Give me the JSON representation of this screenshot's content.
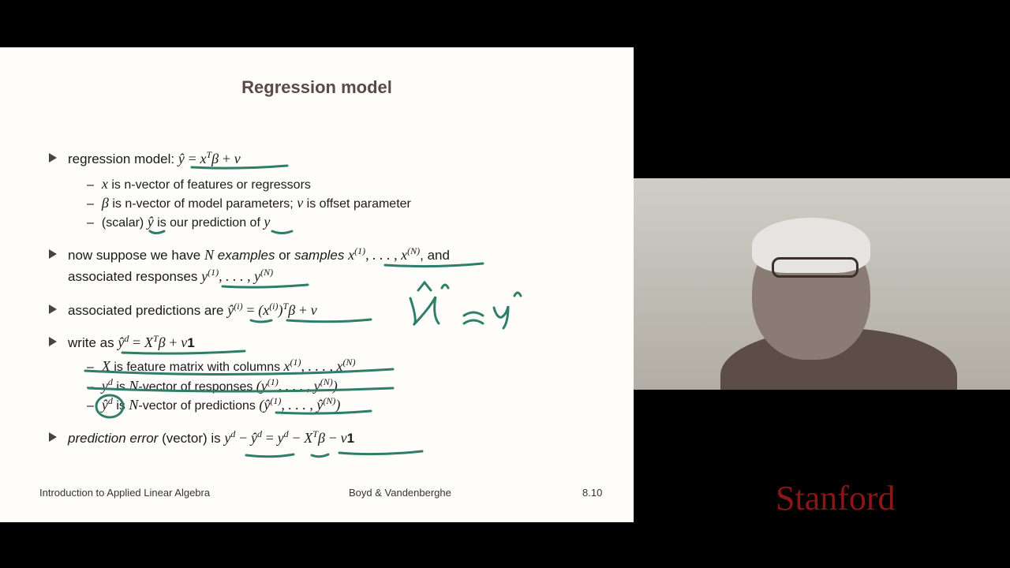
{
  "slide": {
    "title": "Regression model",
    "b1": {
      "lead": "regression model:",
      "sub1_text": "is n-vector of features or regressors",
      "sub2_text": "is n-vector of model parameters;",
      "sub2_tail": "is offset parameter",
      "sub3_a": "(scalar)",
      "sub3_b": "is our prediction of"
    },
    "b2": {
      "a": "now suppose we have",
      "examples": "examples",
      "or": "or",
      "samples": "samples",
      "and": ", and",
      "line2": "associated responses"
    },
    "b3": {
      "lead": "associated predictions are"
    },
    "b4": {
      "lead": "write as",
      "s1": "is feature matrix with columns",
      "s2": "is",
      "s2b": "-vector of responses",
      "s3": "is",
      "s3b": "-vector of predictions"
    },
    "b5": {
      "lead": "prediction error",
      "mid": "(vector) is"
    },
    "footer": {
      "left": "Introduction to Applied Linear Algebra",
      "center": "Boyd & Vandenberghe",
      "right": "8.10"
    }
  },
  "logo": "Stanford",
  "colors": {
    "slide_bg": "#fffdfa",
    "title": "#5a4a45",
    "ink": "#2f7d6b",
    "brand": "#8c1515"
  }
}
